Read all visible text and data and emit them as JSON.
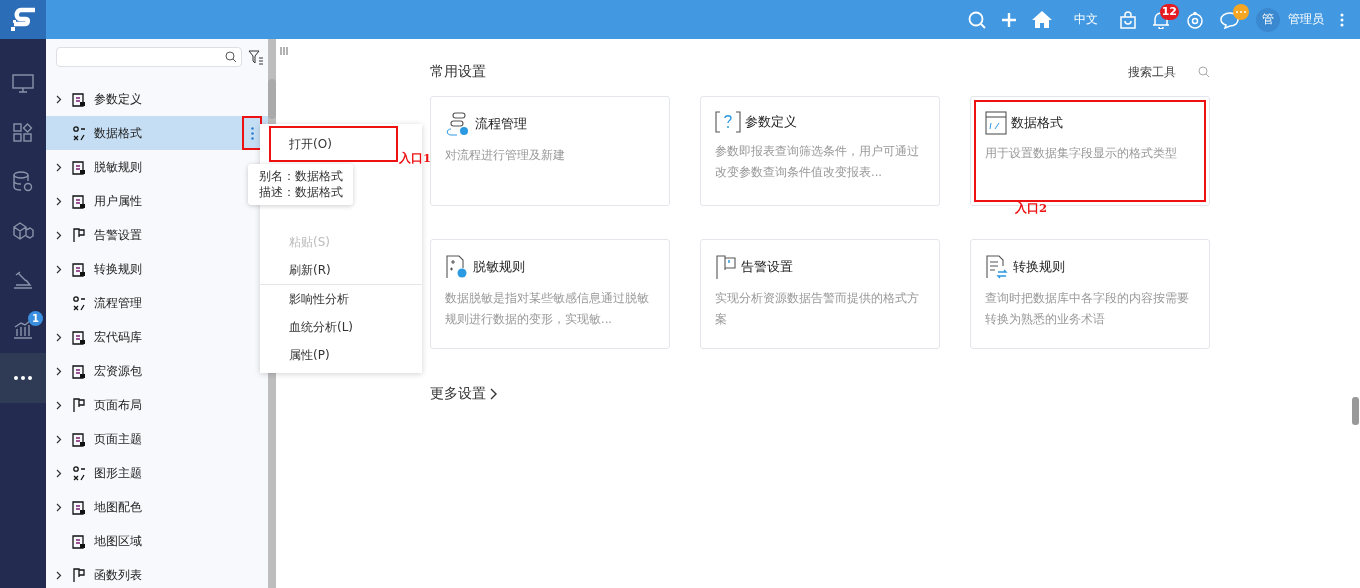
{
  "topbar": {
    "language": "中文",
    "notifications": "12",
    "avatar": "管",
    "user": "管理员"
  },
  "rail": [
    {
      "selected": false
    },
    {
      "selected": false
    },
    {
      "selected": false
    },
    {
      "selected": false
    },
    {
      "selected": false
    },
    {
      "selected": false,
      "badge": "1"
    },
    {
      "selected": true
    }
  ],
  "tree": {
    "more_button": {
      "highlighted": true
    },
    "items": [
      {
        "label": "参数定义",
        "expandable": true,
        "selected": false,
        "highlighted": false
      },
      {
        "label": "数据格式",
        "expandable": false,
        "selected": true,
        "highlighted": false
      },
      {
        "label": "脱敏规则",
        "expandable": true,
        "selected": false,
        "highlighted": false
      },
      {
        "label": "用户属性",
        "expandable": true,
        "selected": false,
        "highlighted": false
      },
      {
        "label": "告警设置",
        "expandable": true,
        "selected": false,
        "highlighted": false
      },
      {
        "label": "转换规则",
        "expandable": true,
        "selected": false,
        "highlighted": false
      },
      {
        "label": "流程管理",
        "expandable": false,
        "selected": false,
        "highlighted": false
      },
      {
        "label": "宏代码库",
        "expandable": true,
        "selected": false,
        "highlighted": false
      },
      {
        "label": "宏资源包",
        "expandable": true,
        "selected": false,
        "highlighted": false
      },
      {
        "label": "页面布局",
        "expandable": true,
        "selected": false,
        "highlighted": false
      },
      {
        "label": "页面主题",
        "expandable": true,
        "selected": false,
        "highlighted": false
      },
      {
        "label": "图形主题",
        "expandable": true,
        "selected": false,
        "highlighted": false
      },
      {
        "label": "地图配色",
        "expandable": true,
        "selected": false,
        "highlighted": false
      },
      {
        "label": "地图区域",
        "expandable": false,
        "selected": false,
        "highlighted": false
      },
      {
        "label": "函数列表",
        "expandable": true,
        "selected": false,
        "highlighted": false
      }
    ]
  },
  "context_menu": [
    {
      "label": "打开(O)",
      "disabled": false,
      "divider_before": false,
      "highlighted": true
    },
    {
      "label": "粘贴(S)",
      "disabled": true,
      "divider_before": false,
      "highlighted": false
    },
    {
      "label": "刷新(R)",
      "disabled": false,
      "divider_before": false,
      "highlighted": false
    },
    {
      "label": "影响性分析",
      "disabled": false,
      "divider_before": true,
      "highlighted": false
    },
    {
      "label": "血统分析(L)",
      "disabled": false,
      "divider_before": false,
      "highlighted": false
    },
    {
      "label": "属性(P)",
      "disabled": false,
      "divider_before": false,
      "highlighted": false
    }
  ],
  "tooltip": [
    "别名：数据格式",
    "描述：数据格式"
  ],
  "main": {
    "title": "常用设置",
    "search_tool": "搜索工具",
    "cards": [
      {
        "title": "流程管理",
        "description": "对流程进行管理及新建",
        "highlighted": false
      },
      {
        "title": "参数定义",
        "description": "参数即报表查询筛选条件，用户可通过改变参数查询条件值改变报表...",
        "highlighted": false
      },
      {
        "title": "数据格式",
        "description": "用于设置数据集字段显示的格式类型",
        "highlighted": true
      },
      {
        "title": "脱敏规则",
        "description": "数据脱敏是指对某些敏感信息通过脱敏规则进行数据的变形，实现敏...",
        "highlighted": false
      },
      {
        "title": "告警设置",
        "description": "实现分析资源数据告警而提供的格式方案",
        "highlighted": false
      },
      {
        "title": "转换规则",
        "description": "查询时把数据库中各字段的内容按需要转换为熟悉的业务术语",
        "highlighted": false
      }
    ],
    "more": "更多设置"
  },
  "annotations": [
    "入口1",
    "入口2"
  ]
}
